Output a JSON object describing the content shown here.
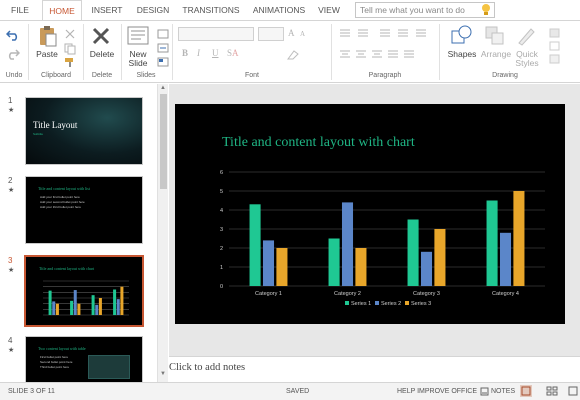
{
  "tabs": [
    {
      "label": "FILE",
      "active": false
    },
    {
      "label": "HOME",
      "active": true
    },
    {
      "label": "INSERT",
      "active": false
    },
    {
      "label": "DESIGN",
      "active": false
    },
    {
      "label": "TRANSITIONS",
      "active": false
    },
    {
      "label": "ANIMATIONS",
      "active": false
    },
    {
      "label": "VIEW",
      "active": false
    }
  ],
  "tell_me": {
    "placeholder": "Tell me what you want to do"
  },
  "ribbon": {
    "groups": {
      "undo": "Undo",
      "clipboard": "Clipboard",
      "delete": "Delete",
      "slides": "Slides",
      "font": "Font",
      "paragraph": "Paragraph",
      "drawing": "Drawing"
    },
    "paste_label": "Paste",
    "delete_label": "Delete",
    "new_slide_label_1": "New",
    "new_slide_label_2": "Slide",
    "shapes_label": "Shapes",
    "arrange_label": "Arrange",
    "quick_styles_label_1": "Quick",
    "quick_styles_label_2": "Styles",
    "font_glyphs": {
      "bold": "B",
      "italic": "I",
      "underline": "U",
      "strike": "S",
      "grow": "A",
      "shrink": "A",
      "color": "A"
    }
  },
  "thumbnails": [
    {
      "number": "1",
      "title": "Title Layout",
      "subtitle": "Subtitle"
    },
    {
      "number": "2",
      "title": "Title and content layout with list",
      "bullets": [
        "Add your first bullet point here",
        "Add your second bullet point here",
        "Add your third bullet point here"
      ]
    },
    {
      "number": "3",
      "title": "Title and content layout with chart"
    },
    {
      "number": "4",
      "title": "Two content layout with table",
      "bullets": [
        "First bullet point here",
        "Second bullet point here",
        "Third bullet point here"
      ]
    }
  ],
  "slide": {
    "title": "Title and content layout with chart"
  },
  "chart_data": {
    "type": "bar",
    "categories": [
      "Category 1",
      "Category 2",
      "Category 3",
      "Category 4"
    ],
    "series": [
      {
        "name": "Series 1",
        "color": "#1fc893",
        "values": [
          4.3,
          2.5,
          3.5,
          4.5
        ]
      },
      {
        "name": "Series 2",
        "color": "#5b86c9",
        "values": [
          2.4,
          4.4,
          1.8,
          2.8
        ]
      },
      {
        "name": "Series 3",
        "color": "#e8a62a",
        "values": [
          2.0,
          2.0,
          3.0,
          5.0
        ]
      }
    ],
    "y_ticks": [
      "0",
      "1",
      "2",
      "3",
      "4",
      "5",
      "6"
    ],
    "ylim": [
      0,
      6
    ],
    "grid": true,
    "legend": "bottom",
    "title": "",
    "xlabel": "",
    "ylabel": ""
  },
  "notes": {
    "placeholder": "Click to add notes"
  },
  "status": {
    "slide_of": "SLIDE 3 OF 11",
    "saved": "SAVED",
    "help": "HELP IMPROVE OFFICE",
    "notes": "NOTES"
  }
}
